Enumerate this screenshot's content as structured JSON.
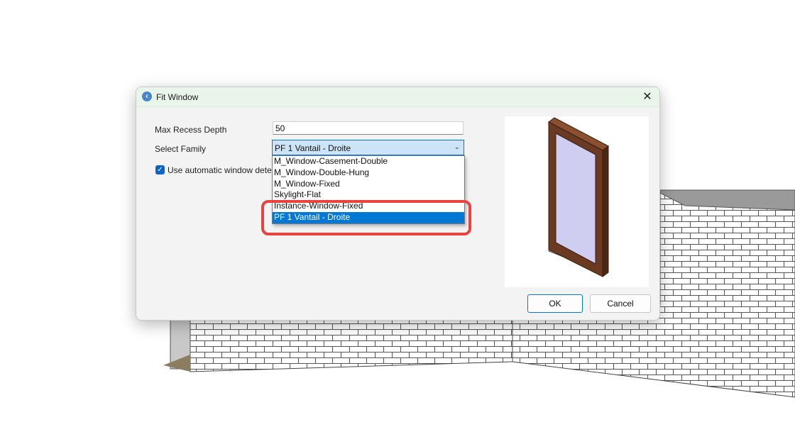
{
  "dialog": {
    "title": "Fit Window",
    "fields": {
      "max_recess_depth_label": "Max Recess Depth",
      "max_recess_depth_value": "50",
      "select_family_label": "Select Family",
      "select_family_value": "PF 1 Vantail - Droite",
      "auto_detect_label": "Use automatic window detec",
      "auto_detect_checked": true
    },
    "family_options": [
      "M_Window-Casement-Double",
      "M_Window-Double-Hung",
      "M_Window-Fixed",
      "Skylight-Flat",
      "Instance-Window-Fixed",
      "PF 1 Vantail - Droite"
    ],
    "selected_option": "PF 1 Vantail - Droite",
    "buttons": {
      "ok": "OK",
      "cancel": "Cancel"
    }
  },
  "icons": {
    "app": "revit-plugin-icon",
    "close": "close-icon",
    "chevron": "chevron-down-icon",
    "check": "checkmark-icon"
  },
  "colors": {
    "accent": "#0078d4",
    "highlight": "#e8433e",
    "titlebar": "#eaf5ea"
  }
}
